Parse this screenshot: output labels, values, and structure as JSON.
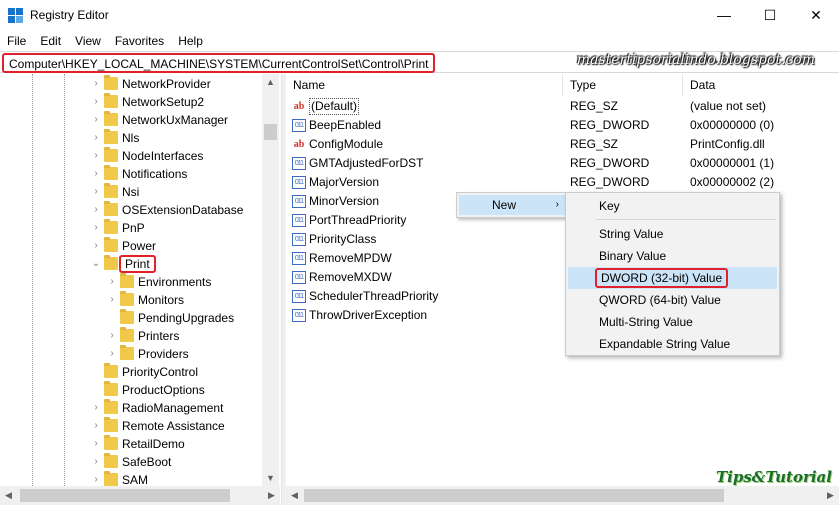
{
  "window": {
    "title": "Registry Editor",
    "minimize_glyph": "—",
    "maximize_glyph": "☐",
    "close_glyph": "✕"
  },
  "menu": [
    "File",
    "Edit",
    "View",
    "Favorites",
    "Help"
  ],
  "address": "Computer\\HKEY_LOCAL_MACHINE\\SYSTEM\\CurrentControlSet\\Control\\Print",
  "watermark": "mastertipsorialindo.blogspot.com",
  "tree": {
    "items": [
      {
        "label": "NetworkProvider",
        "level": 0,
        "expander": "›"
      },
      {
        "label": "NetworkSetup2",
        "level": 0,
        "expander": "›"
      },
      {
        "label": "NetworkUxManager",
        "level": 0,
        "expander": "›"
      },
      {
        "label": "Nls",
        "level": 0,
        "expander": "›"
      },
      {
        "label": "NodeInterfaces",
        "level": 0,
        "expander": "›"
      },
      {
        "label": "Notifications",
        "level": 0,
        "expander": "›"
      },
      {
        "label": "Nsi",
        "level": 0,
        "expander": "›"
      },
      {
        "label": "OSExtensionDatabase",
        "level": 0,
        "expander": "›"
      },
      {
        "label": "PnP",
        "level": 0,
        "expander": "›"
      },
      {
        "label": "Power",
        "level": 0,
        "expander": "›"
      },
      {
        "label": "Print",
        "level": 0,
        "expander": "⌄",
        "selected": true
      },
      {
        "label": "Environments",
        "level": 1,
        "expander": "›"
      },
      {
        "label": "Monitors",
        "level": 1,
        "expander": "›"
      },
      {
        "label": "PendingUpgrades",
        "level": 1,
        "expander": ""
      },
      {
        "label": "Printers",
        "level": 1,
        "expander": "›"
      },
      {
        "label": "Providers",
        "level": 1,
        "expander": "›"
      },
      {
        "label": "PriorityControl",
        "level": 0,
        "expander": ""
      },
      {
        "label": "ProductOptions",
        "level": 0,
        "expander": ""
      },
      {
        "label": "RadioManagement",
        "level": 0,
        "expander": "›"
      },
      {
        "label": "Remote Assistance",
        "level": 0,
        "expander": "›"
      },
      {
        "label": "RetailDemo",
        "level": 0,
        "expander": "›"
      },
      {
        "label": "SafeBoot",
        "level": 0,
        "expander": "›"
      },
      {
        "label": "SAM",
        "level": 0,
        "expander": "›"
      }
    ]
  },
  "columns": {
    "name": "Name",
    "type": "Type",
    "data": "Data"
  },
  "values": [
    {
      "icon": "ab",
      "name": "(Default)",
      "type": "REG_SZ",
      "data": "(value not set)"
    },
    {
      "icon": "bin",
      "name": "BeepEnabled",
      "type": "REG_DWORD",
      "data": "0x00000000 (0)"
    },
    {
      "icon": "ab",
      "name": "ConfigModule",
      "type": "REG_SZ",
      "data": "PrintConfig.dll"
    },
    {
      "icon": "bin",
      "name": "GMTAdjustedForDST",
      "type": "REG_DWORD",
      "data": "0x00000001 (1)"
    },
    {
      "icon": "bin",
      "name": "MajorVersion",
      "type": "REG_DWORD",
      "data": "0x00000002 (2)"
    },
    {
      "icon": "bin",
      "name": "MinorVersion",
      "type": "",
      "data": ""
    },
    {
      "icon": "bin",
      "name": "PortThreadPriority",
      "type": "",
      "data": ""
    },
    {
      "icon": "bin",
      "name": "PriorityClass",
      "type": "",
      "data": ""
    },
    {
      "icon": "bin",
      "name": "RemoveMPDW",
      "type": "",
      "data": ""
    },
    {
      "icon": "bin",
      "name": "RemoveMXDW",
      "type": "",
      "data": ""
    },
    {
      "icon": "bin",
      "name": "SchedulerThreadPriority",
      "type": "",
      "data": ""
    },
    {
      "icon": "bin",
      "name": "ThrowDriverException",
      "type": "",
      "data": ""
    }
  ],
  "context_menu": {
    "new_label": "New",
    "new_arrow": "›"
  },
  "submenu": {
    "key": "Key",
    "items": [
      "String Value",
      "Binary Value",
      "DWORD (32-bit) Value",
      "QWORD (64-bit) Value",
      "Multi-String Value",
      "Expandable String Value"
    ]
  },
  "brand": "Tips&Tutorial",
  "colors": {
    "highlight_border": "#e0202a",
    "menu_hover": "#cce4f7",
    "folder": "#f0c84a"
  }
}
